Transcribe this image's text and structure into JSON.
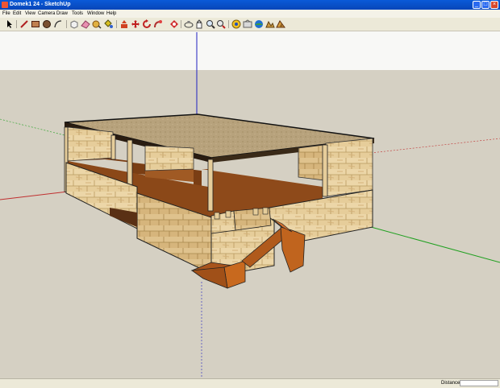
{
  "window": {
    "title": "Domek1 24 - SketchUp"
  },
  "menu": [
    "File",
    "Edit",
    "View",
    "Camera",
    "Draw",
    "Tools",
    "Window",
    "Help"
  ],
  "toolbar_icons": [
    "select-icon",
    "line-icon",
    "rectangle-icon",
    "circle-icon",
    "arc-icon",
    "make-component-icon",
    "eraser-icon",
    "tape-measure-icon",
    "paint-bucket-icon",
    "push-pull-icon",
    "move-icon",
    "rotate-icon",
    "follow-me-icon",
    "offset-icon",
    "orbit-icon",
    "pan-icon",
    "zoom-icon",
    "zoom-extents-icon",
    "get-models-icon",
    "share-model-icon",
    "get-photo-texture-icon",
    "add-location-icon",
    "toggle-terrain-icon"
  ],
  "colors": {
    "sky": "#f8f8f6",
    "ground": "#d5d0c3",
    "red_axis": "#c03030",
    "green_axis": "#20a020",
    "blue_axis": "#2020c0"
  },
  "statusbar": {
    "measurement_label": "Distance",
    "measurement_value": ""
  }
}
